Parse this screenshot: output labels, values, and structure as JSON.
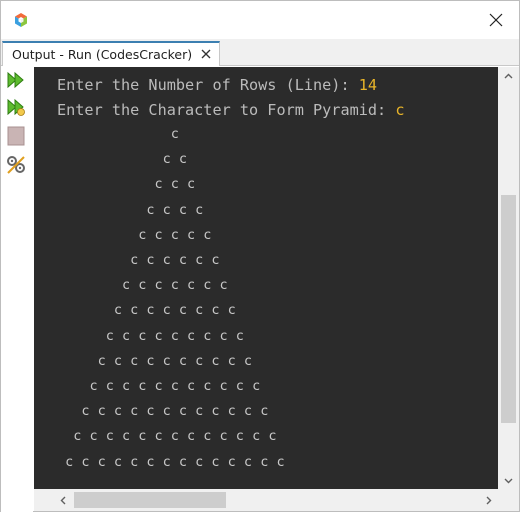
{
  "window": {
    "app_icon": "cube-logo-icon",
    "close_icon": "close-icon"
  },
  "tab": {
    "label": "Output - Run (CodesCracker)",
    "close_icon": "close-icon"
  },
  "toolbar": {
    "buttons": [
      {
        "name": "rerun-icon"
      },
      {
        "name": "rerun-with-options-icon"
      },
      {
        "name": "stop-icon"
      },
      {
        "name": "settings-icon"
      }
    ]
  },
  "console": {
    "prompt_rows": "Enter the Number of Rows (Line): ",
    "rows_value": "14",
    "prompt_char": "Enter the Character to Form Pyramid: ",
    "char_value": "c",
    "pyramid": [
      "              c",
      "             c c",
      "            c c c",
      "           c c c c",
      "          c c c c c",
      "         c c c c c c",
      "        c c c c c c c",
      "       c c c c c c c c",
      "      c c c c c c c c c",
      "     c c c c c c c c c c",
      "    c c c c c c c c c c c",
      "   c c c c c c c c c c c c",
      "  c c c c c c c c c c c c c",
      " c c c c c c c c c c c c c c"
    ]
  },
  "scrollbars": {
    "up_icon": "arrow-up-icon",
    "down_icon": "arrow-down-icon",
    "left_icon": "arrow-left-icon",
    "right_icon": "arrow-right-icon"
  }
}
